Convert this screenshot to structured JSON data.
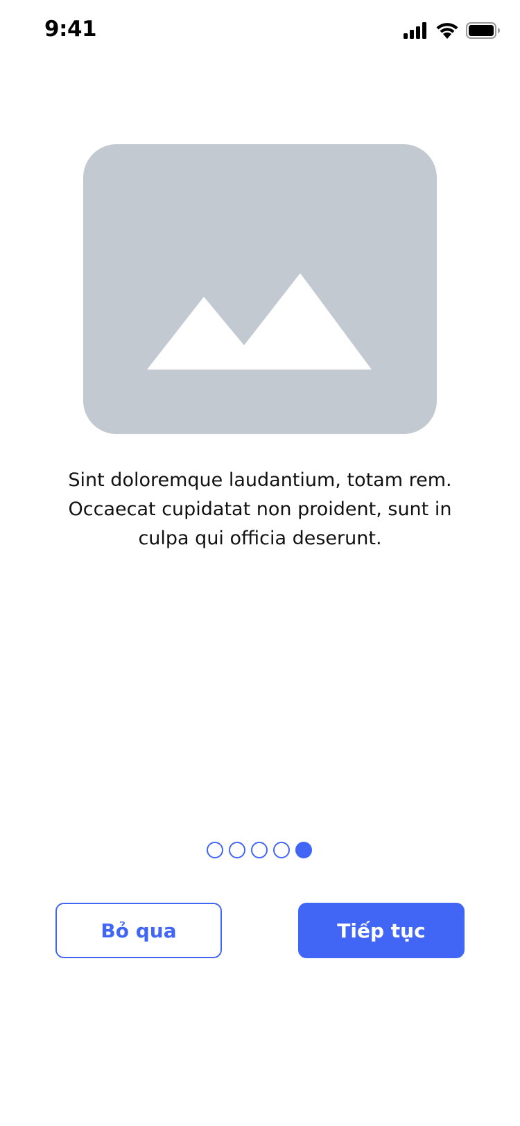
{
  "status_bar": {
    "time": "9:41",
    "icons": [
      "signal-icon",
      "wifi-icon",
      "battery-icon"
    ]
  },
  "hero": {
    "icon": "image-placeholder-icon",
    "background_color": "#c3c9d1"
  },
  "onboarding": {
    "description": "Sint doloremque laudantium, totam rem. Occaecat cupidatat non proident, sunt in culpa qui officia deserunt.",
    "pages_total": 5,
    "current_page": 5
  },
  "actions": {
    "skip_label": "Bỏ qua",
    "next_label": "Tiếp tục"
  },
  "colors": {
    "accent": "#4166f5",
    "placeholder": "#c3c9d1"
  }
}
